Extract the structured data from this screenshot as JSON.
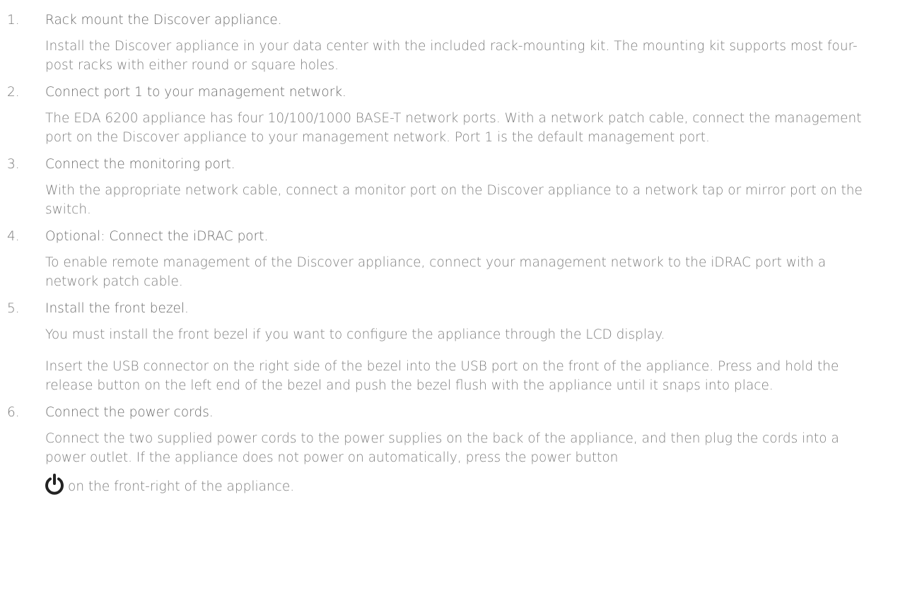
{
  "steps": [
    {
      "number": "1.",
      "title": "Rack mount the Discover appliance.",
      "paragraphs": [
        "Install the Discover appliance in your data center with the included rack-mounting kit. The mounting kit supports most four-post racks with either round or square holes."
      ]
    },
    {
      "number": "2.",
      "title": "Connect port 1 to your management network.",
      "paragraphs": [
        "The EDA 6200 appliance has four 10/100/1000 BASE-T network ports. With a network patch cable, connect the management port on the Discover appliance to your management network. Port 1 is the default management port."
      ]
    },
    {
      "number": "3.",
      "title": "Connect the monitoring port.",
      "paragraphs": [
        "With the appropriate network cable, connect a monitor port on the Discover appliance to a network tap or mirror port on the switch."
      ]
    },
    {
      "number": "4.",
      "title": "Optional: Connect the iDRAC port.",
      "paragraphs": [
        "To enable remote management of the Discover appliance, connect your management network to the iDRAC port with a network patch cable."
      ]
    },
    {
      "number": "5.",
      "title": "Install the front bezel.",
      "paragraphs": [
        "You must install the front bezel if you want to configure the appliance through the LCD display.",
        "Insert the USB connector on the right side of the bezel into the USB port on the front of the appliance. Press and hold the release button on the left end of the bezel and push the bezel flush with the appliance until it snaps into place."
      ]
    },
    {
      "number": "6.",
      "title": "Connect the power cords.",
      "paragraphs": [
        "Connect the two supplied power cords to the power supplies on the back of the appliance, and then plug the cords into a power outlet. If the appliance does not power on automatically, press the power button"
      ],
      "power_icon": "power-icon",
      "trailing_text": "on the front-right of the appliance."
    }
  ],
  "colors": {
    "text": "#6b6b6b",
    "body_text": "#7d7d7d",
    "icon": "#222222"
  }
}
